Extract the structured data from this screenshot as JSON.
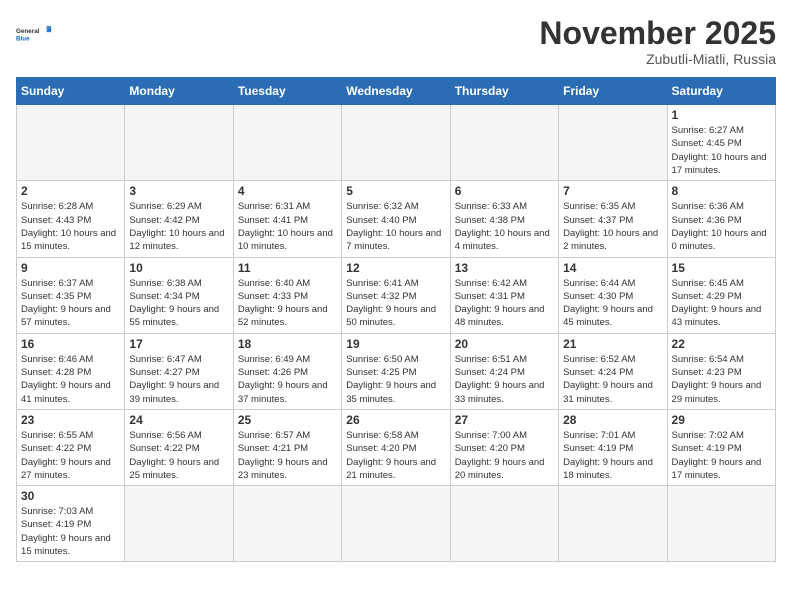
{
  "logo": {
    "general": "General",
    "blue": "Blue"
  },
  "header": {
    "month_year": "November 2025",
    "location": "Zubutli-Miatli, Russia"
  },
  "days_of_week": [
    "Sunday",
    "Monday",
    "Tuesday",
    "Wednesday",
    "Thursday",
    "Friday",
    "Saturday"
  ],
  "weeks": [
    [
      {
        "day": "",
        "info": ""
      },
      {
        "day": "",
        "info": ""
      },
      {
        "day": "",
        "info": ""
      },
      {
        "day": "",
        "info": ""
      },
      {
        "day": "",
        "info": ""
      },
      {
        "day": "",
        "info": ""
      },
      {
        "day": "1",
        "info": "Sunrise: 6:27 AM\nSunset: 4:45 PM\nDaylight: 10 hours and 17 minutes."
      }
    ],
    [
      {
        "day": "2",
        "info": "Sunrise: 6:28 AM\nSunset: 4:43 PM\nDaylight: 10 hours and 15 minutes."
      },
      {
        "day": "3",
        "info": "Sunrise: 6:29 AM\nSunset: 4:42 PM\nDaylight: 10 hours and 12 minutes."
      },
      {
        "day": "4",
        "info": "Sunrise: 6:31 AM\nSunset: 4:41 PM\nDaylight: 10 hours and 10 minutes."
      },
      {
        "day": "5",
        "info": "Sunrise: 6:32 AM\nSunset: 4:40 PM\nDaylight: 10 hours and 7 minutes."
      },
      {
        "day": "6",
        "info": "Sunrise: 6:33 AM\nSunset: 4:38 PM\nDaylight: 10 hours and 4 minutes."
      },
      {
        "day": "7",
        "info": "Sunrise: 6:35 AM\nSunset: 4:37 PM\nDaylight: 10 hours and 2 minutes."
      },
      {
        "day": "8",
        "info": "Sunrise: 6:36 AM\nSunset: 4:36 PM\nDaylight: 10 hours and 0 minutes."
      }
    ],
    [
      {
        "day": "9",
        "info": "Sunrise: 6:37 AM\nSunset: 4:35 PM\nDaylight: 9 hours and 57 minutes."
      },
      {
        "day": "10",
        "info": "Sunrise: 6:38 AM\nSunset: 4:34 PM\nDaylight: 9 hours and 55 minutes."
      },
      {
        "day": "11",
        "info": "Sunrise: 6:40 AM\nSunset: 4:33 PM\nDaylight: 9 hours and 52 minutes."
      },
      {
        "day": "12",
        "info": "Sunrise: 6:41 AM\nSunset: 4:32 PM\nDaylight: 9 hours and 50 minutes."
      },
      {
        "day": "13",
        "info": "Sunrise: 6:42 AM\nSunset: 4:31 PM\nDaylight: 9 hours and 48 minutes."
      },
      {
        "day": "14",
        "info": "Sunrise: 6:44 AM\nSunset: 4:30 PM\nDaylight: 9 hours and 45 minutes."
      },
      {
        "day": "15",
        "info": "Sunrise: 6:45 AM\nSunset: 4:29 PM\nDaylight: 9 hours and 43 minutes."
      }
    ],
    [
      {
        "day": "16",
        "info": "Sunrise: 6:46 AM\nSunset: 4:28 PM\nDaylight: 9 hours and 41 minutes."
      },
      {
        "day": "17",
        "info": "Sunrise: 6:47 AM\nSunset: 4:27 PM\nDaylight: 9 hours and 39 minutes."
      },
      {
        "day": "18",
        "info": "Sunrise: 6:49 AM\nSunset: 4:26 PM\nDaylight: 9 hours and 37 minutes."
      },
      {
        "day": "19",
        "info": "Sunrise: 6:50 AM\nSunset: 4:25 PM\nDaylight: 9 hours and 35 minutes."
      },
      {
        "day": "20",
        "info": "Sunrise: 6:51 AM\nSunset: 4:24 PM\nDaylight: 9 hours and 33 minutes."
      },
      {
        "day": "21",
        "info": "Sunrise: 6:52 AM\nSunset: 4:24 PM\nDaylight: 9 hours and 31 minutes."
      },
      {
        "day": "22",
        "info": "Sunrise: 6:54 AM\nSunset: 4:23 PM\nDaylight: 9 hours and 29 minutes."
      }
    ],
    [
      {
        "day": "23",
        "info": "Sunrise: 6:55 AM\nSunset: 4:22 PM\nDaylight: 9 hours and 27 minutes."
      },
      {
        "day": "24",
        "info": "Sunrise: 6:56 AM\nSunset: 4:22 PM\nDaylight: 9 hours and 25 minutes."
      },
      {
        "day": "25",
        "info": "Sunrise: 6:57 AM\nSunset: 4:21 PM\nDaylight: 9 hours and 23 minutes."
      },
      {
        "day": "26",
        "info": "Sunrise: 6:58 AM\nSunset: 4:20 PM\nDaylight: 9 hours and 21 minutes."
      },
      {
        "day": "27",
        "info": "Sunrise: 7:00 AM\nSunset: 4:20 PM\nDaylight: 9 hours and 20 minutes."
      },
      {
        "day": "28",
        "info": "Sunrise: 7:01 AM\nSunset: 4:19 PM\nDaylight: 9 hours and 18 minutes."
      },
      {
        "day": "29",
        "info": "Sunrise: 7:02 AM\nSunset: 4:19 PM\nDaylight: 9 hours and 17 minutes."
      }
    ],
    [
      {
        "day": "30",
        "info": "Sunrise: 7:03 AM\nSunset: 4:19 PM\nDaylight: 9 hours and 15 minutes."
      },
      {
        "day": "",
        "info": ""
      },
      {
        "day": "",
        "info": ""
      },
      {
        "day": "",
        "info": ""
      },
      {
        "day": "",
        "info": ""
      },
      {
        "day": "",
        "info": ""
      },
      {
        "day": "",
        "info": ""
      }
    ]
  ]
}
